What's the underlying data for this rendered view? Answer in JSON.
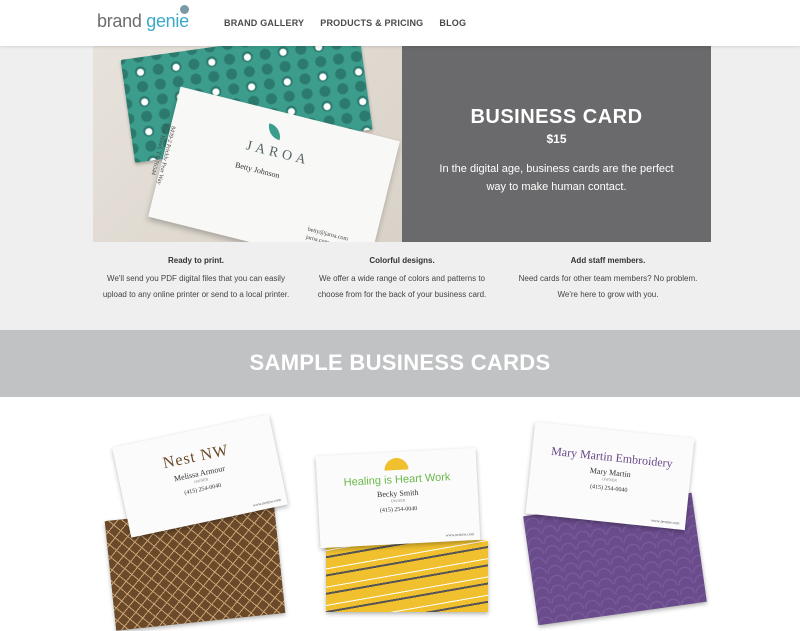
{
  "header": {
    "logo_brand": "brand ",
    "logo_genie": "genie",
    "nav": [
      "BRAND GALLERY",
      "PRODUCTS & PRICING",
      "BLOG"
    ]
  },
  "hero": {
    "title": "BUSINESS CARD",
    "price": "$15",
    "description": "In the digital age, business cards are the perfect way to make human contact.",
    "photo_card": {
      "logo": "JAROA",
      "name": "Betty Johnson",
      "role": "OWNER",
      "address": "8439-2 Prickly Pear Way\nFort Hood, TX 76544",
      "contact": "betty@jaroa.com\njaroa.com"
    }
  },
  "features": [
    {
      "title": "Ready to print.",
      "text": "We'll send you PDF digital files that you can easily upload to any online printer or send to a local printer."
    },
    {
      "title": "Colorful designs.",
      "text": "We offer a wide range of colors and patterns to choose from for the back of your business card."
    },
    {
      "title": "Add staff members.",
      "text": "Need cards for other team members? No problem. We're here to grow with you."
    }
  ],
  "samples": {
    "title": "SAMPLE BUSINESS CARDS",
    "cards": [
      {
        "title": "Nest NW",
        "name": "Melissa Armour",
        "role": "OWNER",
        "phone": "(415) 254-0040",
        "web": "www.nestnw.com"
      },
      {
        "title": "Healing is Heart Work",
        "name": "Becky Smith",
        "role": "OWNER",
        "phone": "(415) 254-0040",
        "web": "www.nestnw.com"
      },
      {
        "title": "Mary Martin Embroidery",
        "name": "Mary Martin",
        "role": "OWNER",
        "phone": "(415) 254-0040",
        "web": "www.nestnw.com"
      }
    ]
  }
}
